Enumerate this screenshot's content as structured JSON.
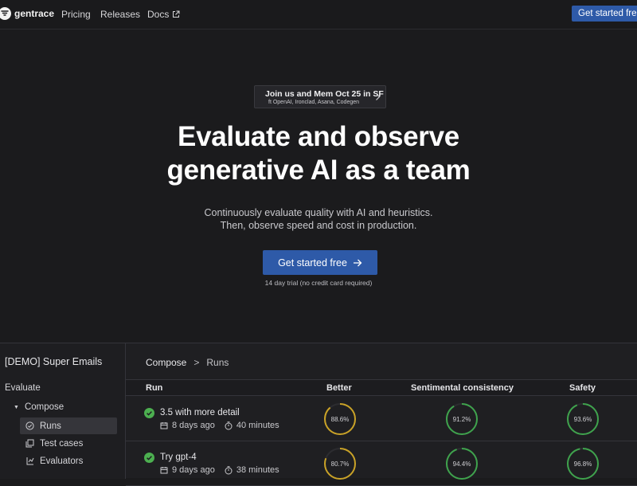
{
  "nav": {
    "logo_text": "gentrace",
    "links": [
      "Pricing",
      "Releases",
      "Docs"
    ],
    "cta": "Get started free"
  },
  "event": {
    "title": "Join us and Mem Oct 25 in SF",
    "subtitle": "ft OpenAI, Ironclad, Asana, Codegen"
  },
  "hero": {
    "title_line1": "Evaluate and observe",
    "title_line2": "generative AI as a team",
    "subtitle_line1": "Continuously evaluate quality with AI and heuristics.",
    "subtitle_line2": "Then, observe speed and cost in production.",
    "cta": "Get started free",
    "trial_note": "14 day trial (no credit card required)"
  },
  "demo": {
    "sidebar": {
      "title": "[DEMO] Super Emails",
      "evaluate": "Evaluate",
      "compose": "Compose",
      "items": [
        "Runs",
        "Test cases",
        "Evaluators"
      ]
    },
    "breadcrumb": {
      "parent": "Compose",
      "separator": ">",
      "current": "Runs"
    },
    "columns": [
      "Run",
      "Better",
      "Sentimental consistency",
      "Safety"
    ],
    "rows": [
      {
        "name": "3.5 with more detail",
        "age": "8 days ago",
        "duration": "40 minutes",
        "scores": [
          {
            "label": "88.6%",
            "value": 0.886,
            "color": "#c9a227"
          },
          {
            "label": "91.2%",
            "value": 0.912,
            "color": "#3fa34d"
          },
          {
            "label": "93.6%",
            "value": 0.936,
            "color": "#3fa34d"
          }
        ]
      },
      {
        "name": "Try gpt-4",
        "age": "9 days ago",
        "duration": "38 minutes",
        "scores": [
          {
            "label": "80.7%",
            "value": 0.807,
            "color": "#c9a227"
          },
          {
            "label": "94.4%",
            "value": 0.944,
            "color": "#3fa34d"
          },
          {
            "label": "96.8%",
            "value": 0.968,
            "color": "#3fa34d"
          }
        ]
      }
    ]
  },
  "colors": {
    "accent": "#2e5aa8",
    "success": "#4caf50",
    "warning": "#c9a227"
  }
}
